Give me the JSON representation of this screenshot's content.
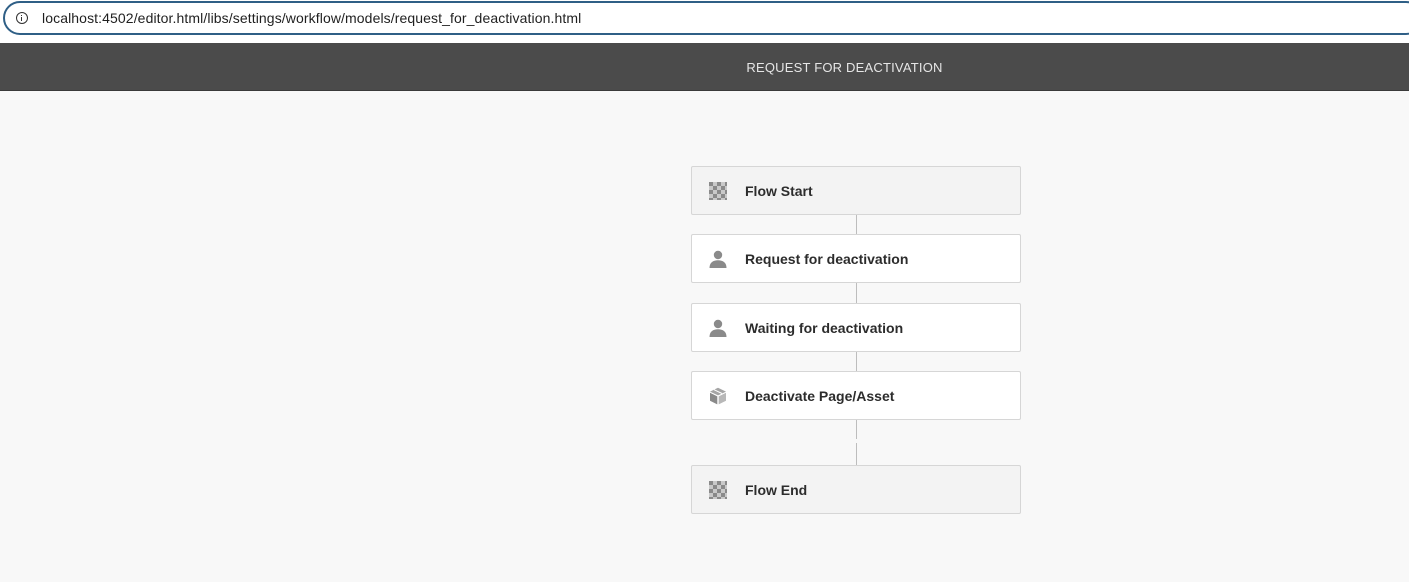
{
  "browser": {
    "url": "localhost:4502/editor.html/libs/settings/workflow/models/request_for_deactivation.html"
  },
  "header": {
    "title": "REQUEST FOR DEACTIVATION"
  },
  "workflow": {
    "steps": [
      {
        "label": "Flow Start",
        "icon": "flow-marker-icon",
        "kind": "terminal"
      },
      {
        "label": "Request for deactivation",
        "icon": "user-icon",
        "kind": "participant"
      },
      {
        "label": "Waiting for deactivation",
        "icon": "user-icon",
        "kind": "participant"
      },
      {
        "label": "Deactivate Page/Asset",
        "icon": "box-icon",
        "kind": "process"
      },
      {
        "label": "Flow End",
        "icon": "flow-marker-icon",
        "kind": "terminal"
      }
    ]
  },
  "colors": {
    "header_bg": "#4b4b4b",
    "url_border": "#2f5f86",
    "canvas_bg": "#f8f8f8",
    "icon_gray": "#8a8a8a"
  }
}
